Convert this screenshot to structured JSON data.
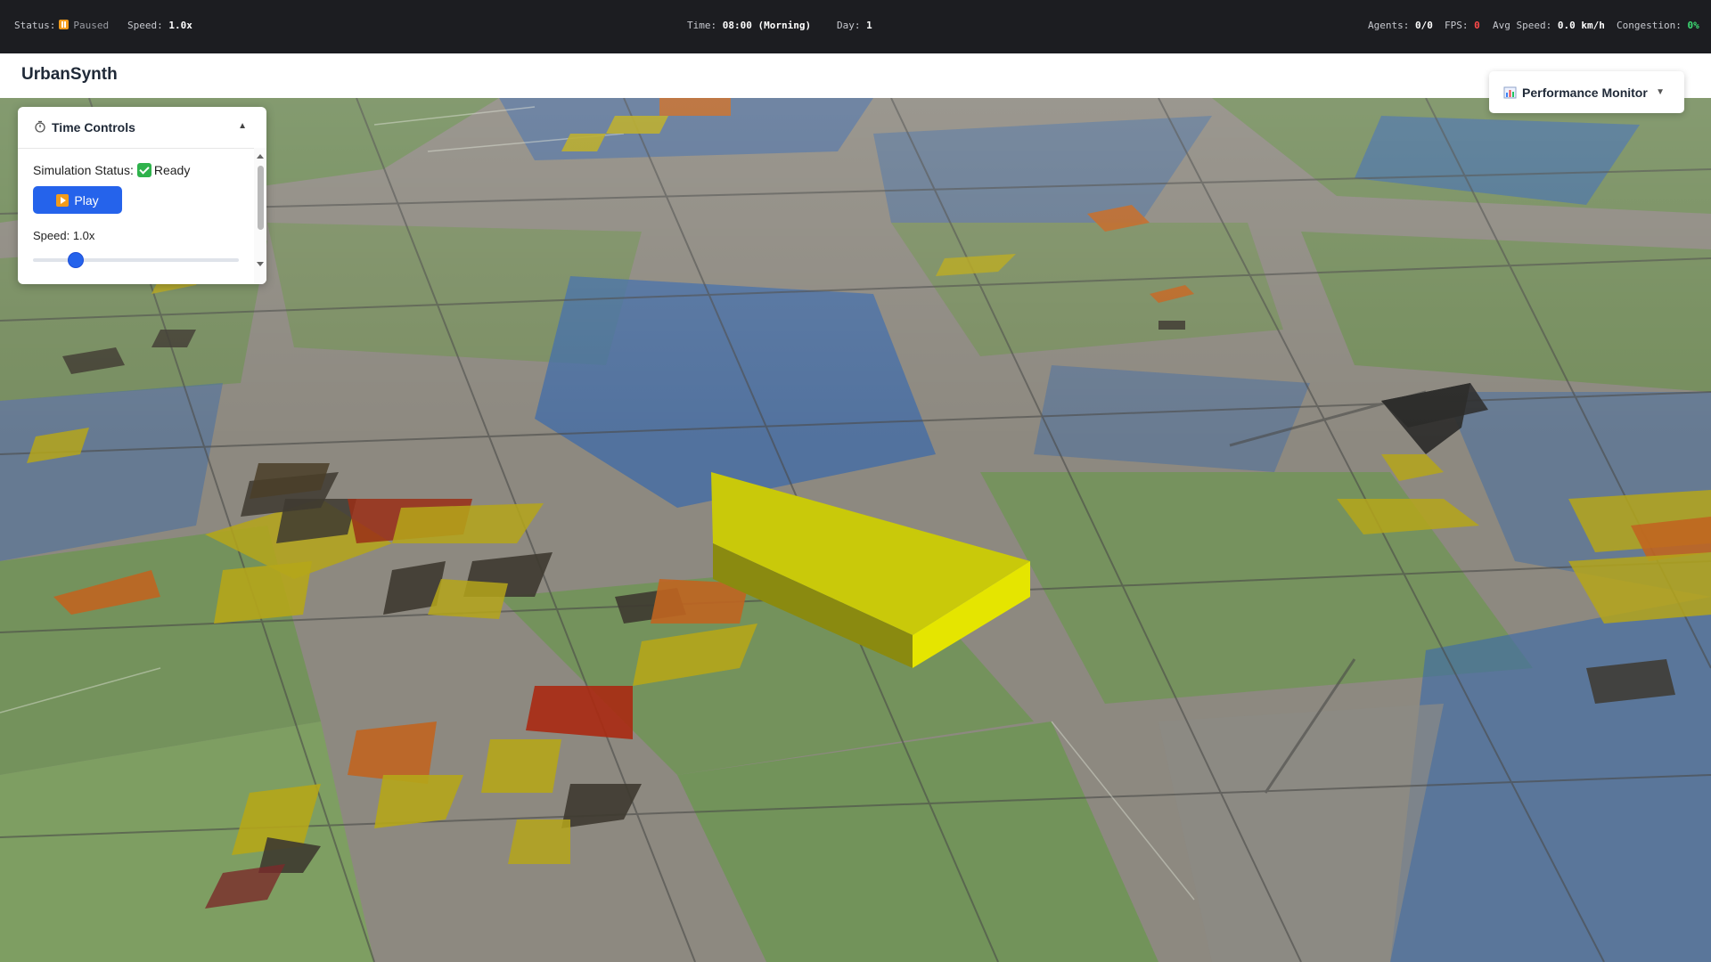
{
  "statusbar": {
    "status_label": "Status:",
    "status_value": "Paused",
    "speed_label": "Speed:",
    "speed_value": "1.0x",
    "time_label": "Time:",
    "time_value": "08:00 (Morning)",
    "day_label": "Day:",
    "day_value": "1",
    "agents_label": "Agents:",
    "agents_value": "0/0",
    "fps_label": "FPS:",
    "fps_value": "0",
    "avgspeed_label": "Avg Speed:",
    "avgspeed_value": "0.0 km/h",
    "congestion_label": "Congestion:",
    "congestion_value": "0%",
    "colors": {
      "paused": "#f29b1a",
      "fps": "#ff4a4a",
      "congestion": "#3ddc74"
    }
  },
  "app": {
    "title": "UrbanSynth"
  },
  "time_controls": {
    "title": "Time Controls",
    "icon": "stopwatch-icon",
    "collapse_icon": "chevron-up-icon",
    "status_label": "Simulation Status:",
    "status_value": "Ready",
    "play_label": "Play",
    "speed_label": "Speed: 1.0x",
    "speed_slider_fraction": 0.17
  },
  "performance_monitor": {
    "title": "Performance Monitor",
    "icon": "bar-chart-icon",
    "expand_icon": "chevron-down-icon"
  },
  "map": {
    "selected_building_color": "#e5e500",
    "zone_colors": {
      "residential": "#5d8a3a",
      "commercial": "#3f6ba8",
      "industrial": "#8a8580"
    }
  }
}
